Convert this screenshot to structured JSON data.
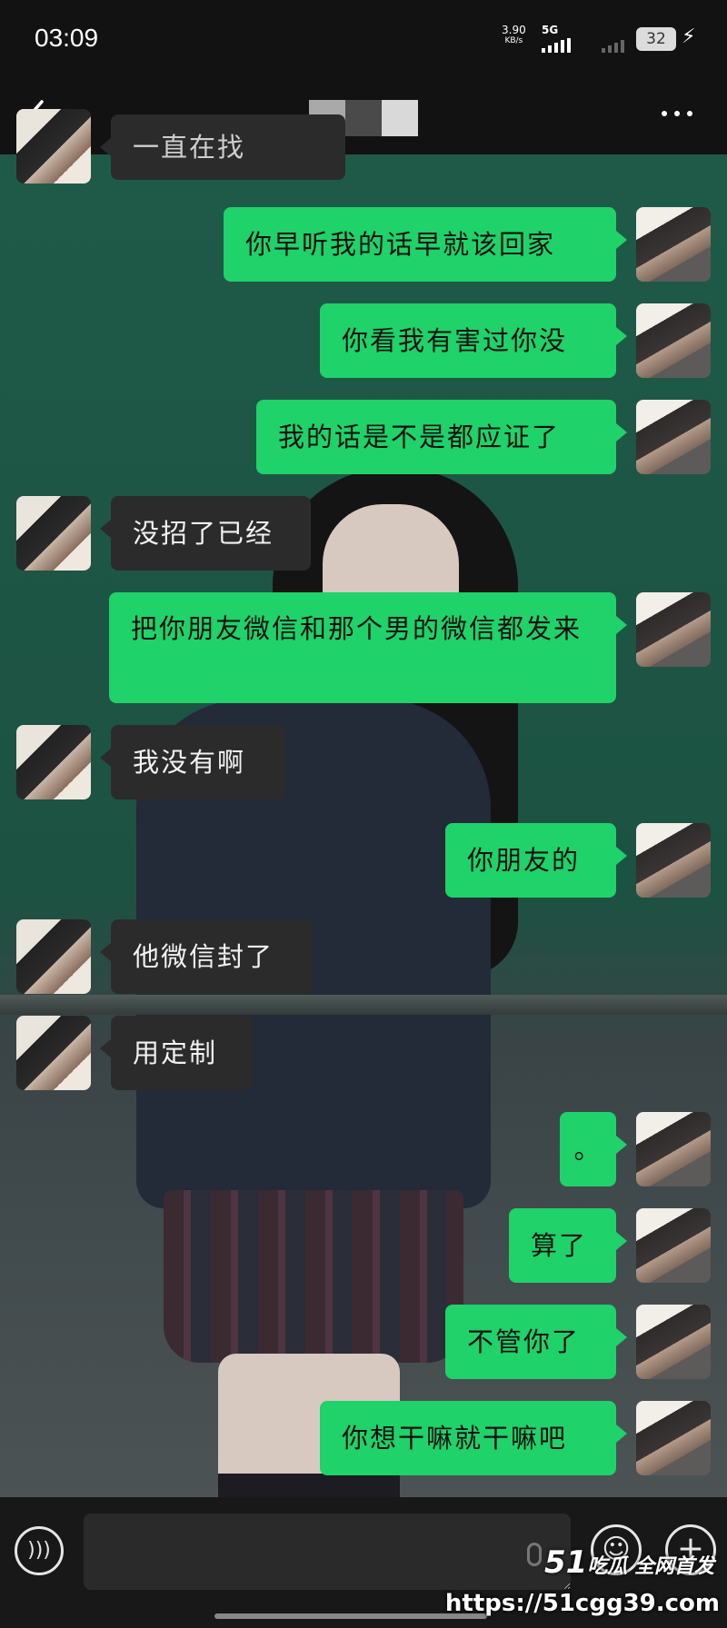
{
  "status_bar": {
    "time": "03:09",
    "net_speed_value": "3.90",
    "net_speed_unit": "KB/s",
    "network": "5G",
    "battery": "32"
  },
  "header": {
    "back_icon": "chevron-left-icon",
    "contact_name": "",
    "more_icon": "more-dots-icon"
  },
  "messages": [
    {
      "side": "recv",
      "text": "一直在找"
    },
    {
      "side": "sent",
      "text": "你早听我的话早就该回家"
    },
    {
      "side": "sent",
      "text": "你看我有害过你没"
    },
    {
      "side": "sent",
      "text": "我的话是不是都应证了"
    },
    {
      "side": "recv",
      "text": "没招了已经"
    },
    {
      "side": "sent",
      "text": "把你朋友微信和那个男的微信都发来"
    },
    {
      "side": "recv",
      "text": "我没有啊"
    },
    {
      "side": "sent",
      "text": "你朋友的"
    },
    {
      "side": "recv",
      "text": "他微信封了"
    },
    {
      "side": "recv",
      "text": "用定制"
    },
    {
      "side": "sent",
      "text": "。"
    },
    {
      "side": "sent",
      "text": "算了"
    },
    {
      "side": "sent",
      "text": "不管你了"
    },
    {
      "side": "sent",
      "text": "你想干嘛就干嘛吧"
    }
  ],
  "input_bar": {
    "voice_icon": "voice-icon",
    "emoji_icon": "emoji-icon",
    "plus_icon": "plus-icon",
    "input_value": ""
  },
  "watermark": {
    "brand_number": "51",
    "brand_text": "吃瓜 全网首发",
    "url": "https://51cgg39.com"
  },
  "colors": {
    "sent_bubble": "#1fd26a",
    "recv_bubble": "#2b2b2b",
    "bar_background": "#121212"
  }
}
